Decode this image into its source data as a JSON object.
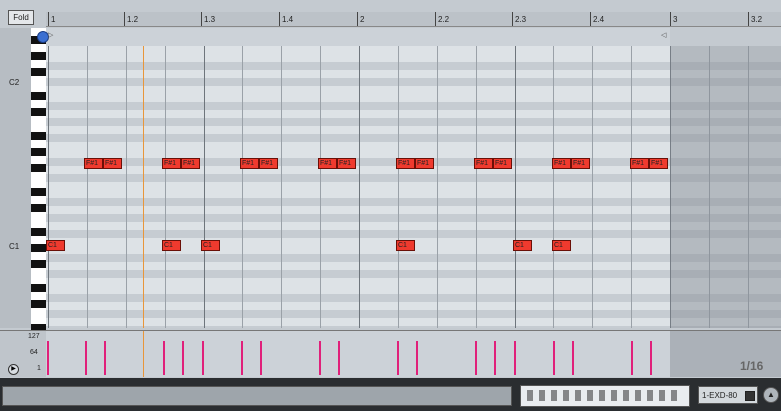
{
  "toolbar": {
    "fold_label": "Fold"
  },
  "ruler": {
    "labels": [
      "1",
      "1.2",
      "1.3",
      "1.4",
      "2",
      "2.2",
      "2.3",
      "2.4",
      "3",
      "3.2"
    ]
  },
  "keyboard": {
    "labels": [
      "C2",
      "C1"
    ]
  },
  "notes": {
    "sharp_label": "F#1",
    "c_label": "C1"
  },
  "velocity": {
    "ticks": [
      "127",
      "64",
      "1"
    ],
    "max": 127,
    "grid_fraction": "1/16"
  },
  "device": {
    "name": "1-EXD-80"
  },
  "colors": {
    "note_fill": "#ef3a2e",
    "velocity_stem": "#e0207a",
    "playhead": "#e8963a",
    "background": "#c4cad0"
  }
}
